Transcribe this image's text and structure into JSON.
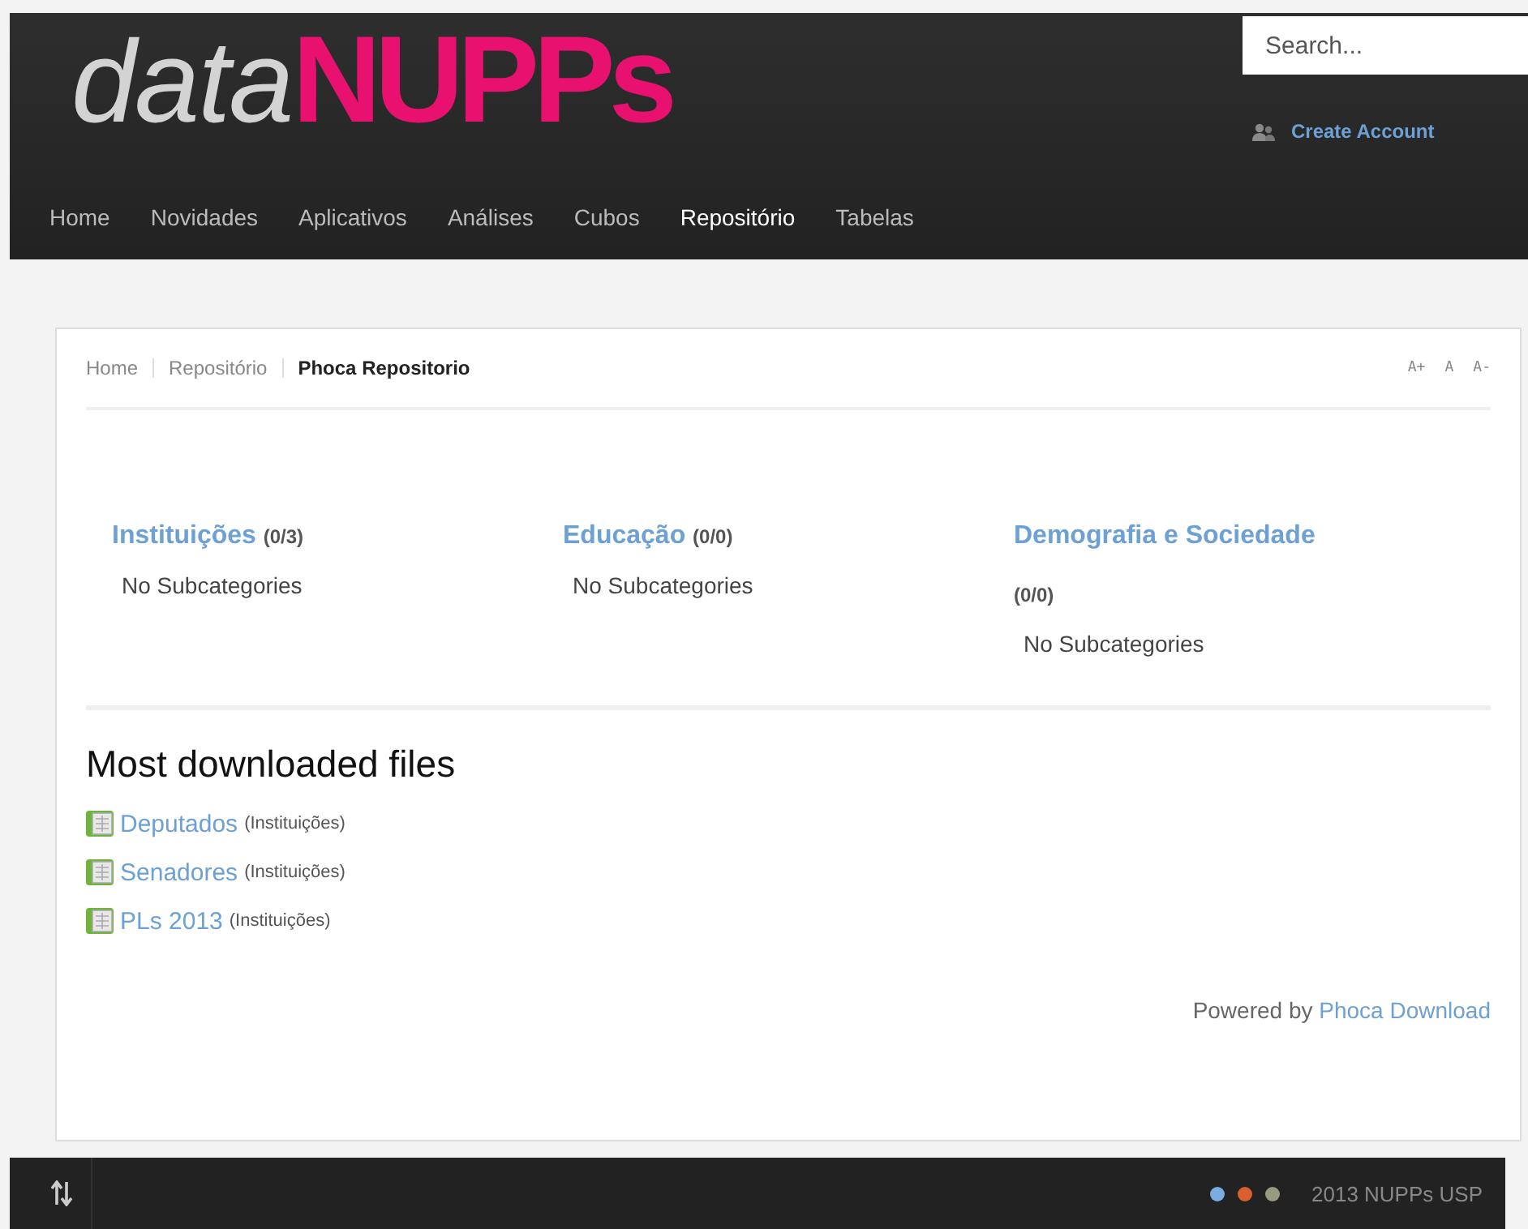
{
  "logo": {
    "light": "data",
    "bold": "NUPPs"
  },
  "search": {
    "placeholder": "Search..."
  },
  "account_link": "Create Account",
  "nav": [
    {
      "label": "Home",
      "selected": false
    },
    {
      "label": "Novidades",
      "selected": false
    },
    {
      "label": "Aplicativos",
      "selected": false
    },
    {
      "label": "Análises",
      "selected": false
    },
    {
      "label": "Cubos",
      "selected": false
    },
    {
      "label": "Repositório",
      "selected": true
    },
    {
      "label": "Tabelas",
      "selected": false
    }
  ],
  "breadcrumb": [
    {
      "label": "Home",
      "current": false
    },
    {
      "label": "Repositório",
      "current": false
    },
    {
      "label": "Phoca Repositorio",
      "current": true
    }
  ],
  "font_size_controls": [
    "A+",
    "A",
    "A-"
  ],
  "categories": [
    {
      "title": "Instituições",
      "count": "(0/3)",
      "note": "No Subcategories"
    },
    {
      "title": "Educação",
      "count": "(0/0)",
      "note": "No Subcategories"
    },
    {
      "title": "Demografia e Sociedade",
      "count": "(0/0)",
      "note": "No Subcategories"
    }
  ],
  "most_downloaded": {
    "heading": "Most downloaded files",
    "files": [
      {
        "name": "Deputados",
        "category": "(Instituições)"
      },
      {
        "name": "Senadores",
        "category": "(Instituições)"
      },
      {
        "name": "PLs 2013",
        "category": "(Instituições)"
      }
    ]
  },
  "powered_by": {
    "text": "Powered by",
    "link": "Phoca Download"
  },
  "footer": {
    "swatches": [
      {
        "color": "#7aaee0"
      },
      {
        "color": "#d9602f"
      },
      {
        "color": "#9a9a80"
      }
    ],
    "copyright": "2013 NUPPs USP"
  }
}
